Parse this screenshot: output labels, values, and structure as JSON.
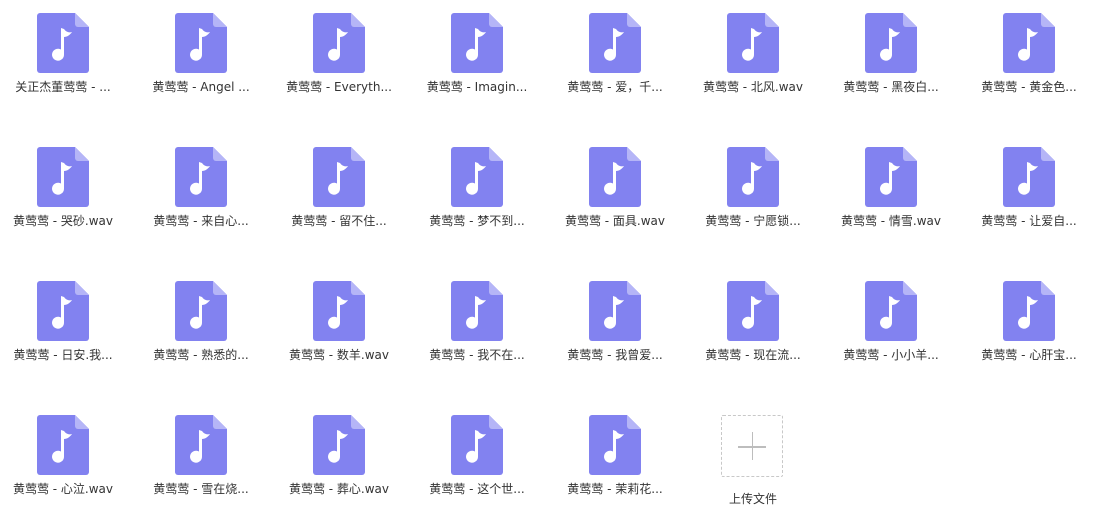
{
  "colors": {
    "icon_body": "#8282f0",
    "icon_fold": "#b5b5f7",
    "icon_glyph": "#ffffff",
    "label_text": "#333333",
    "upload_border": "#c8c8c8"
  },
  "files": [
    {
      "name": "关正杰董莺莺 - ...",
      "icon": "music-file-icon"
    },
    {
      "name": "黄莺莺 - Angel ...",
      "icon": "music-file-icon"
    },
    {
      "name": "黄莺莺 - Everyth...",
      "icon": "music-file-icon"
    },
    {
      "name": "黄莺莺 - Imagin...",
      "icon": "music-file-icon"
    },
    {
      "name": "黄莺莺 - 爱，千...",
      "icon": "music-file-icon"
    },
    {
      "name": "黄莺莺 - 北风.wav",
      "icon": "music-file-icon"
    },
    {
      "name": "黄莺莺 - 黑夜白...",
      "icon": "music-file-icon"
    },
    {
      "name": "黄莺莺 - 黄金色...",
      "icon": "music-file-icon"
    },
    {
      "name": "黄莺莺 - 哭砂.wav",
      "icon": "music-file-icon"
    },
    {
      "name": "黄莺莺 - 来自心...",
      "icon": "music-file-icon"
    },
    {
      "name": "黄莺莺 - 留不住...",
      "icon": "music-file-icon"
    },
    {
      "name": "黄莺莺 - 梦不到...",
      "icon": "music-file-icon"
    },
    {
      "name": "黄莺莺 - 面具.wav",
      "icon": "music-file-icon"
    },
    {
      "name": "黄莺莺 - 宁愿锁...",
      "icon": "music-file-icon"
    },
    {
      "name": "黄莺莺 - 情雪.wav",
      "icon": "music-file-icon"
    },
    {
      "name": "黄莺莺 - 让爱自...",
      "icon": "music-file-icon"
    },
    {
      "name": "黄莺莺 - 日安.我...",
      "icon": "music-file-icon"
    },
    {
      "name": "黄莺莺 - 熟悉的...",
      "icon": "music-file-icon"
    },
    {
      "name": "黄莺莺 - 数羊.wav",
      "icon": "music-file-icon"
    },
    {
      "name": "黄莺莺 - 我不在...",
      "icon": "music-file-icon"
    },
    {
      "name": "黄莺莺 - 我曾爱...",
      "icon": "music-file-icon"
    },
    {
      "name": "黄莺莺 - 现在流...",
      "icon": "music-file-icon"
    },
    {
      "name": "黄莺莺 - 小小羊...",
      "icon": "music-file-icon"
    },
    {
      "name": "黄莺莺 - 心肝宝...",
      "icon": "music-file-icon"
    },
    {
      "name": "黄莺莺 - 心泣.wav",
      "icon": "music-file-icon"
    },
    {
      "name": "黄莺莺 - 雪在烧...",
      "icon": "music-file-icon"
    },
    {
      "name": "黄莺莺 - 葬心.wav",
      "icon": "music-file-icon"
    },
    {
      "name": "黄莺莺 - 这个世...",
      "icon": "music-file-icon"
    },
    {
      "name": "黄莺莺 - 茉莉花...",
      "icon": "music-file-icon"
    }
  ],
  "upload": {
    "label": "上传文件",
    "icon": "plus-icon"
  }
}
